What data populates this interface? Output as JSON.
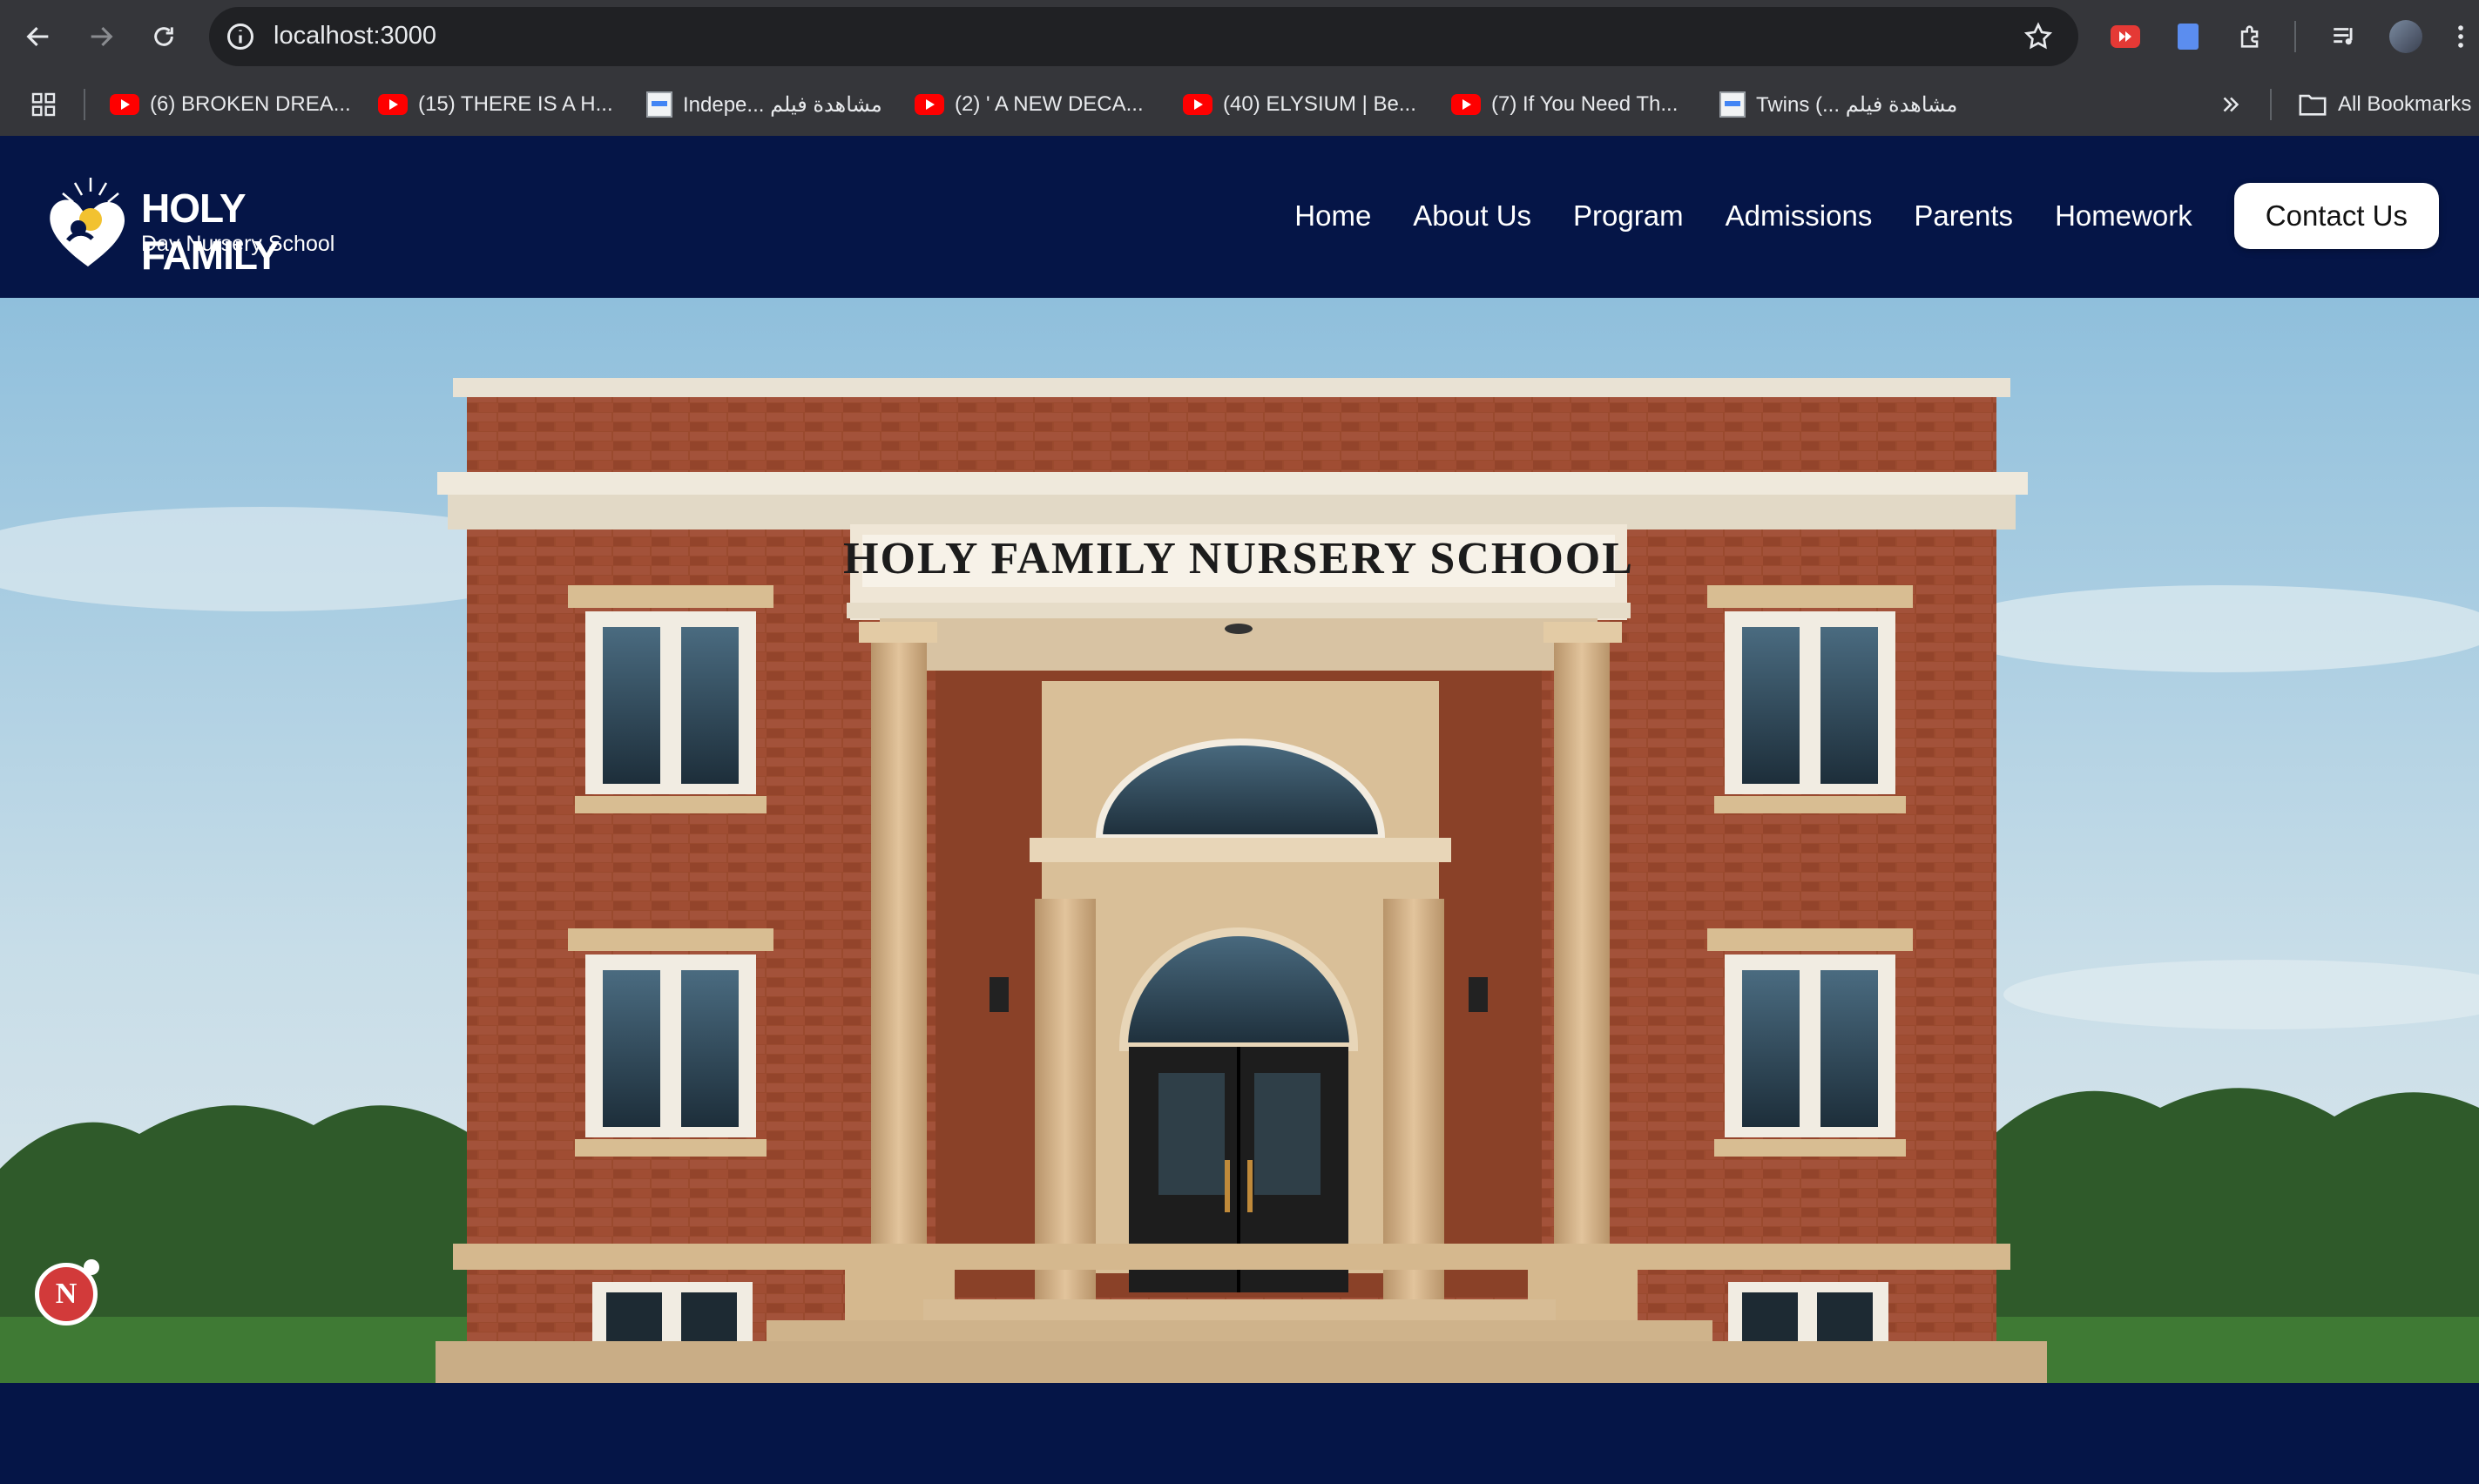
{
  "browser": {
    "url": "localhost:3000",
    "bookmarks": [
      {
        "label": "(6) BROKEN DREA...",
        "icon": "youtube-icon"
      },
      {
        "label": "(15) THERE IS A H...",
        "icon": "youtube-icon"
      },
      {
        "label": "Indepe... مشاهدة فيلم",
        "icon": "site-icon"
      },
      {
        "label": "(2) ' A NEW DECA...",
        "icon": "youtube-icon"
      },
      {
        "label": "(40) ELYSIUM | Be...",
        "icon": "youtube-icon"
      },
      {
        "label": "(7) If You Need Th...",
        "icon": "youtube-icon"
      },
      {
        "label": "Twins (... مشاهدة فيلم",
        "icon": "site-icon"
      }
    ],
    "all_bookmarks": "All Bookmarks"
  },
  "site": {
    "logo_title": "HOLY FAMILY",
    "logo_subtitle": "Day Nursery School",
    "nav": [
      "Home",
      "About Us",
      "Program",
      "Admissions",
      "Parents",
      "Homework"
    ],
    "contact": "Contact Us",
    "hero_sign": "HOLY FAMILY NURSERY SCHOOL"
  },
  "dev_badge": "N",
  "colors": {
    "navy": "#051547",
    "brick": "#9a4a2e",
    "stone": "#d7b48a",
    "youtube_red": "#ff0000"
  }
}
